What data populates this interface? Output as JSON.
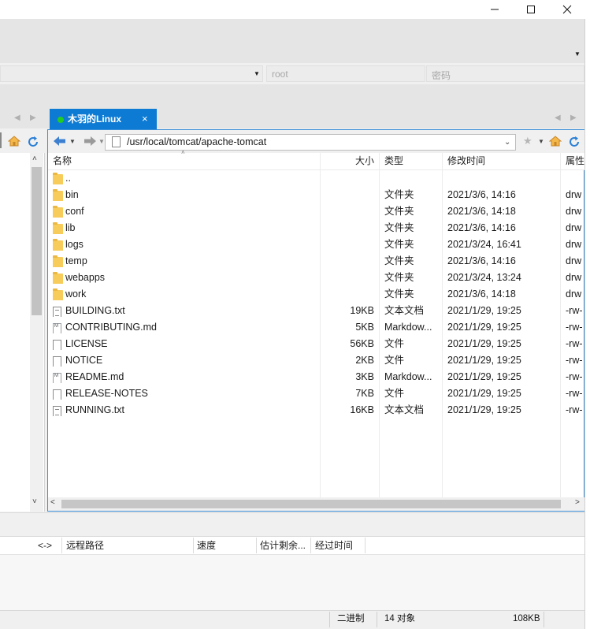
{
  "window": {
    "minimize_glyph": "—",
    "maximize_glyph": "☐",
    "close_glyph": "✕"
  },
  "connection": {
    "username_value": "root",
    "password_placeholder": "密码"
  },
  "tabs": {
    "active_label": "木羽的Linux",
    "close_glyph": "×"
  },
  "remote": {
    "path": "/usr/local/tomcat/apache-tomcat",
    "columns": {
      "name": "名称",
      "size": "大小",
      "type": "类型",
      "modified": "修改时间",
      "attributes": "属性"
    },
    "files": [
      {
        "name": "..",
        "icon": "folder-icon",
        "size": "",
        "type": "",
        "modified": "",
        "attr": ""
      },
      {
        "name": "bin",
        "icon": "folder-icon",
        "size": "",
        "type": "文件夹",
        "modified": "2021/3/6, 14:16",
        "attr": "drw"
      },
      {
        "name": "conf",
        "icon": "folder-icon",
        "size": "",
        "type": "文件夹",
        "modified": "2021/3/6, 14:18",
        "attr": "drw"
      },
      {
        "name": "lib",
        "icon": "folder-icon",
        "size": "",
        "type": "文件夹",
        "modified": "2021/3/6, 14:16",
        "attr": "drw"
      },
      {
        "name": "logs",
        "icon": "folder-icon",
        "size": "",
        "type": "文件夹",
        "modified": "2021/3/24, 16:41",
        "attr": "drw"
      },
      {
        "name": "temp",
        "icon": "folder-icon",
        "size": "",
        "type": "文件夹",
        "modified": "2021/3/6, 14:16",
        "attr": "drw"
      },
      {
        "name": "webapps",
        "icon": "folder-icon",
        "size": "",
        "type": "文件夹",
        "modified": "2021/3/24, 13:24",
        "attr": "drw"
      },
      {
        "name": "work",
        "icon": "folder-icon",
        "size": "",
        "type": "文件夹",
        "modified": "2021/3/6, 14:18",
        "attr": "drw"
      },
      {
        "name": "BUILDING.txt",
        "icon": "text-file-icon",
        "size": "19KB",
        "type": "文本文档",
        "modified": "2021/1/29, 19:25",
        "attr": "-rw-"
      },
      {
        "name": "CONTRIBUTING.md",
        "icon": "markdown-file-icon",
        "size": "5KB",
        "type": "Markdow...",
        "modified": "2021/1/29, 19:25",
        "attr": "-rw-"
      },
      {
        "name": "LICENSE",
        "icon": "file-icon",
        "size": "56KB",
        "type": "文件",
        "modified": "2021/1/29, 19:25",
        "attr": "-rw-"
      },
      {
        "name": "NOTICE",
        "icon": "file-icon",
        "size": "2KB",
        "type": "文件",
        "modified": "2021/1/29, 19:25",
        "attr": "-rw-"
      },
      {
        "name": "README.md",
        "icon": "markdown-file-icon",
        "size": "3KB",
        "type": "Markdow...",
        "modified": "2021/1/29, 19:25",
        "attr": "-rw-"
      },
      {
        "name": "RELEASE-NOTES",
        "icon": "file-icon",
        "size": "7KB",
        "type": "文件",
        "modified": "2021/1/29, 19:25",
        "attr": "-rw-"
      },
      {
        "name": "RUNNING.txt",
        "icon": "text-file-icon",
        "size": "16KB",
        "type": "文本文档",
        "modified": "2021/1/29, 19:25",
        "attr": "-rw-"
      }
    ]
  },
  "transfers": {
    "columns": {
      "direction": "<->",
      "remote_path": "远程路径",
      "speed": "速度",
      "remaining": "估计剩余...",
      "elapsed": "经过时间"
    }
  },
  "status": {
    "mode": "二进制",
    "object_count": "14 对象",
    "total_size": "108KB"
  },
  "colors": {
    "accent": "#0d7bd4",
    "online_dot": "#22cc22",
    "folder": "#f7cc5a"
  }
}
